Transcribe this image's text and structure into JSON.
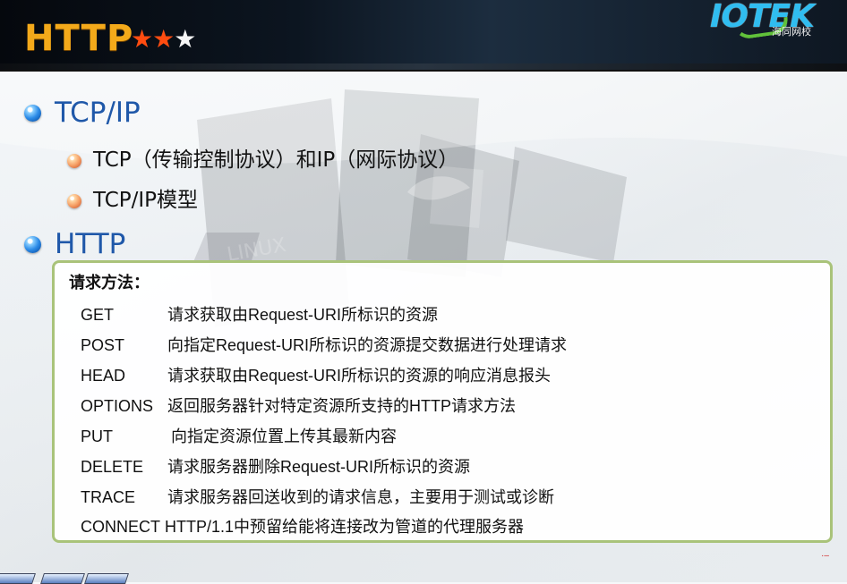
{
  "slide": {
    "title": "HTTP",
    "rating": {
      "filled": "★★",
      "empty": "★"
    },
    "logo": {
      "name": "IOTEK",
      "subtext": "海同网校"
    }
  },
  "outline": {
    "section_1": "TCP/IP",
    "section_1_items": [
      "TCP（传输控制协议）和IP（网际协议）",
      "TCP/IP模型"
    ],
    "section_2": "HTTP"
  },
  "methods_panel": {
    "heading": "请求方法：",
    "rows": [
      {
        "method": "GET",
        "description": "请求获取由Request-URI所标识的资源"
      },
      {
        "method": "POST",
        "description": "向指定Request-URI所标识的资源提交数据进行处理请求"
      },
      {
        "method": "HEAD",
        "description": "请求获取由Request-URI所标识的资源的响应消息报头"
      },
      {
        "method": "OPTIONS",
        "description": "返回服务器针对特定资源所支持的HTTP请求方法"
      },
      {
        "method": "PUT",
        "description": "向指定资源位置上传其最新内容"
      },
      {
        "method": "DELETE",
        "description": "请求服务器删除Request-URI所标识的资源"
      },
      {
        "method": "TRACE",
        "description": "请求服务器回送收到的请求信息，主要用于测试或诊断"
      },
      {
        "method": "CONNECT",
        "description": "HTTP/1.1中预留给能将连接改为管道的代理服务器"
      }
    ]
  },
  "colors": {
    "title": "#f3a91a",
    "heading_blue": "#1f58a9",
    "panel_border": "#a9c37a"
  }
}
